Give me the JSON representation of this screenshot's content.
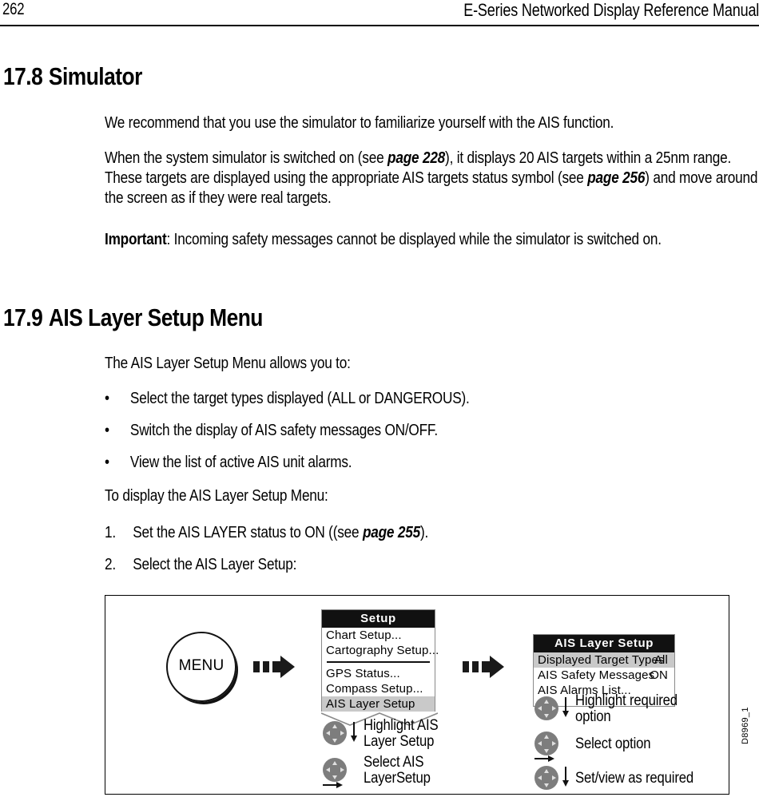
{
  "header": {
    "page_number": "262",
    "title": "E-Series Networked Display Reference Manual"
  },
  "sections": [
    {
      "number": "17.8",
      "title": "Simulator",
      "paragraphs": [
        {
          "id": "p1",
          "parts": [
            {
              "text": "We recommend that you use the simulator to familiarize yourself with the AIS function.",
              "style": "normal"
            }
          ]
        },
        {
          "id": "p2",
          "parts": [
            {
              "text": "When the system simulator is switched on (see ",
              "style": "normal"
            },
            {
              "text": "page 228",
              "style": "italic"
            },
            {
              "text": "), it displays 20 AIS targets within a 25nm range. These targets are displayed using the appropriate AIS targets status symbol (see ",
              "style": "normal"
            },
            {
              "text": "page 256",
              "style": "italic"
            },
            {
              "text": ") and move around the screen as if they were real targets.",
              "style": "normal"
            }
          ]
        },
        {
          "id": "p3",
          "parts": [
            {
              "text": "Important",
              "style": "bold"
            },
            {
              "text": ": Incoming safety messages cannot be displayed while the simulator is switched on.",
              "style": "normal"
            }
          ]
        }
      ]
    },
    {
      "number": "17.9",
      "title": "AIS Layer Setup Menu",
      "intro": "The AIS Layer Setup Menu allows you to:",
      "bullets": [
        "Select the target types displayed (ALL or DANGEROUS).",
        "Switch the display of AIS safety messages ON/OFF.",
        "View the list of active AIS unit alarms."
      ],
      "procedure_intro": "To display the AIS Layer Setup Menu:",
      "steps": [
        {
          "number": "1.",
          "parts": [
            {
              "text": "Set the AIS LAYER status to ON ((see ",
              "style": "normal"
            },
            {
              "text": "page 255",
              "style": "italic"
            },
            {
              "text": ").",
              "style": "normal"
            }
          ]
        },
        {
          "number": "2.",
          "parts": [
            {
              "text": "Select the AIS Layer Setup:",
              "style": "normal"
            }
          ]
        }
      ]
    }
  ],
  "figure": {
    "id_label": "D8969_1",
    "menu_button_label": "MENU",
    "setup_menu": {
      "title": "Setup",
      "items_top": [
        {
          "label": "Chart Setup...",
          "highlighted": false
        },
        {
          "label": "Cartography Setup...",
          "highlighted": false
        }
      ],
      "items_bottom": [
        {
          "label": "GPS Status...",
          "highlighted": false
        },
        {
          "label": "Compass Setup...",
          "highlighted": false
        },
        {
          "label": "AIS Layer Setup",
          "highlighted": true
        }
      ]
    },
    "ais_layer_setup_menu": {
      "title": "AIS Layer Setup",
      "rows": [
        {
          "label": "Displayed Target Types",
          "value": "All",
          "highlighted": true
        },
        {
          "label": "AIS Safety Messages",
          "value": "ON",
          "highlighted": false
        },
        {
          "label": "AIS Alarms List...",
          "value": "",
          "highlighted": false
        }
      ]
    },
    "left_steps": [
      {
        "line1": "Highlight AIS",
        "line2": "Layer Setup",
        "hint": "down"
      },
      {
        "line1": "Select AIS",
        "line2": "LayerSetup",
        "hint": "right"
      }
    ],
    "right_steps": [
      {
        "line1": "Highlight required",
        "line2": "option",
        "hint": "down"
      },
      {
        "line1": "Select option",
        "line2": "",
        "hint": "right"
      },
      {
        "line1": "Set/view as required",
        "line2": "",
        "hint": "down"
      }
    ]
  },
  "colors": {
    "highlight_gray": "#c9c9c9",
    "title_bar": "#111111",
    "trackpad_gray": "#7d7d7d",
    "panel_border": "#8a8a8a"
  }
}
